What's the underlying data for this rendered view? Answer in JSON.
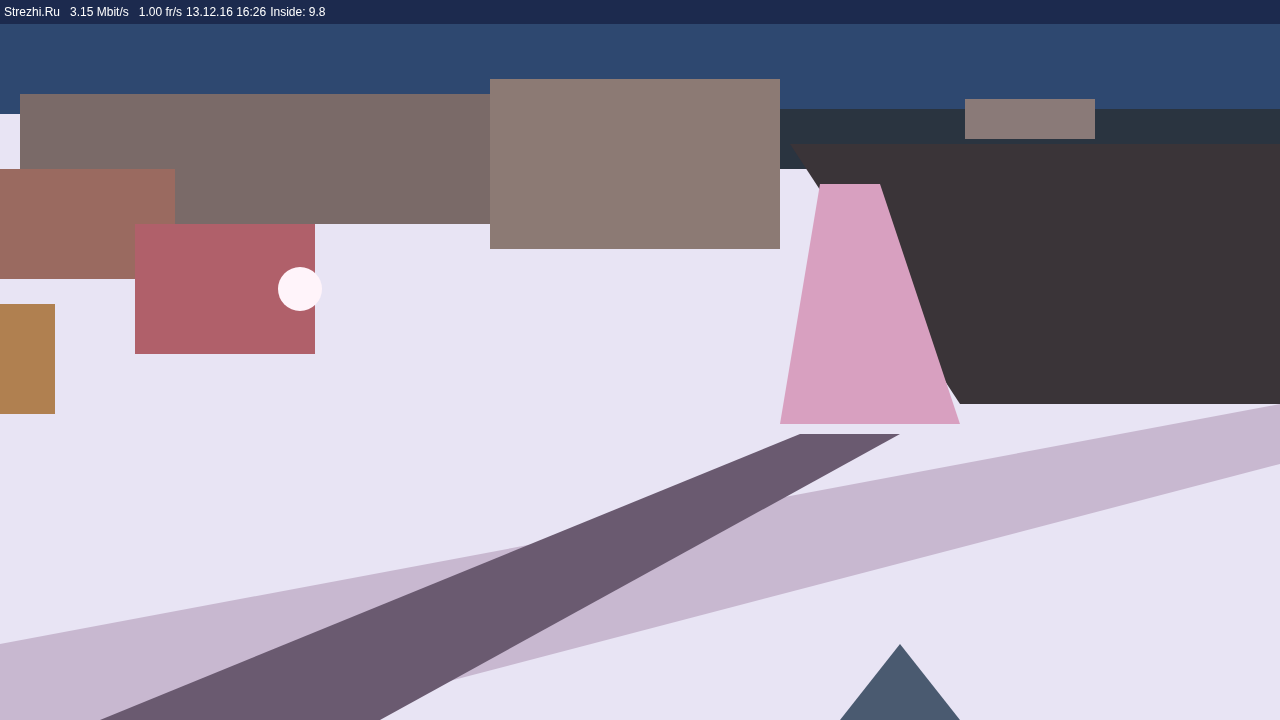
{
  "overlay": {
    "site": "Strezhi.Ru",
    "bitrate": "3.15 Mbit/s",
    "framerate": "1.00 fr/s",
    "datetime": "13.12.16 16:26",
    "inside": "Inside: 9.8"
  }
}
